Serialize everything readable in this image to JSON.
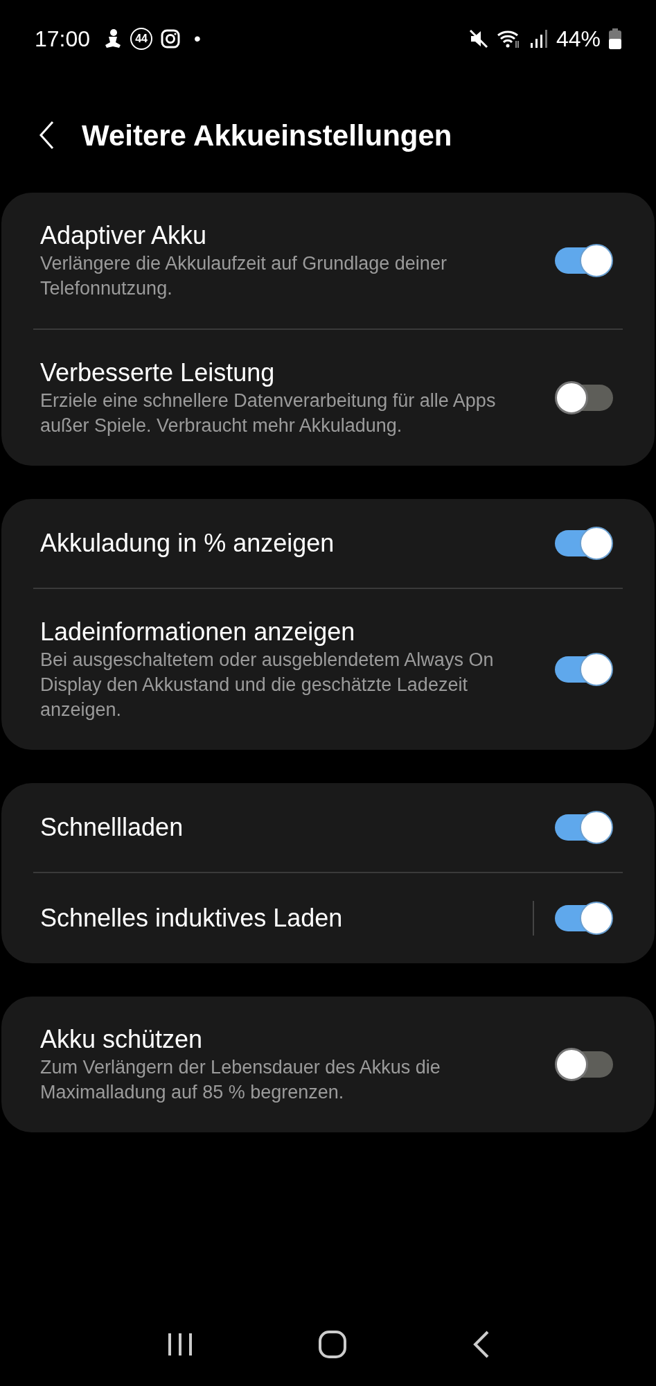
{
  "status_bar": {
    "time": "17:00",
    "notification_badge": "44",
    "dot": "•",
    "battery_text": "44%"
  },
  "header": {
    "title": "Weitere Akkueinstellungen"
  },
  "groups": [
    {
      "items": [
        {
          "kind": "plain",
          "title": "Adaptiver Akku",
          "subtitle": "Verlängere die Akkulaufzeit auf Grundlage deiner Telefonnutzung.",
          "on": true
        },
        {
          "kind": "plain",
          "title": "Verbesserte Leistung",
          "subtitle": "Erziele eine schnellere Datenverarbeitung für alle Apps außer Spiele. Verbraucht mehr Akkuladung.",
          "on": false
        }
      ]
    },
    {
      "items": [
        {
          "kind": "plain",
          "title": "Akkuladung in % anzeigen",
          "on": true
        },
        {
          "kind": "plain",
          "title": "Ladeinformationen anzeigen",
          "subtitle": "Bei ausgeschaltetem oder ausgeblendetem Always On Display den Akkustand und die geschätzte Ladezeit anzeigen.",
          "on": true
        }
      ]
    },
    {
      "items": [
        {
          "kind": "plain",
          "title": "Schnellladen",
          "on": true
        },
        {
          "kind": "split",
          "title": "Schnelles induktives Laden",
          "on": true
        }
      ]
    },
    {
      "items": [
        {
          "kind": "plain",
          "title": "Akku schützen",
          "subtitle": "Zum Verlängern der Lebensdauer des Akkus die Maximalladung auf 85 % begrenzen.",
          "on": false
        }
      ]
    }
  ]
}
